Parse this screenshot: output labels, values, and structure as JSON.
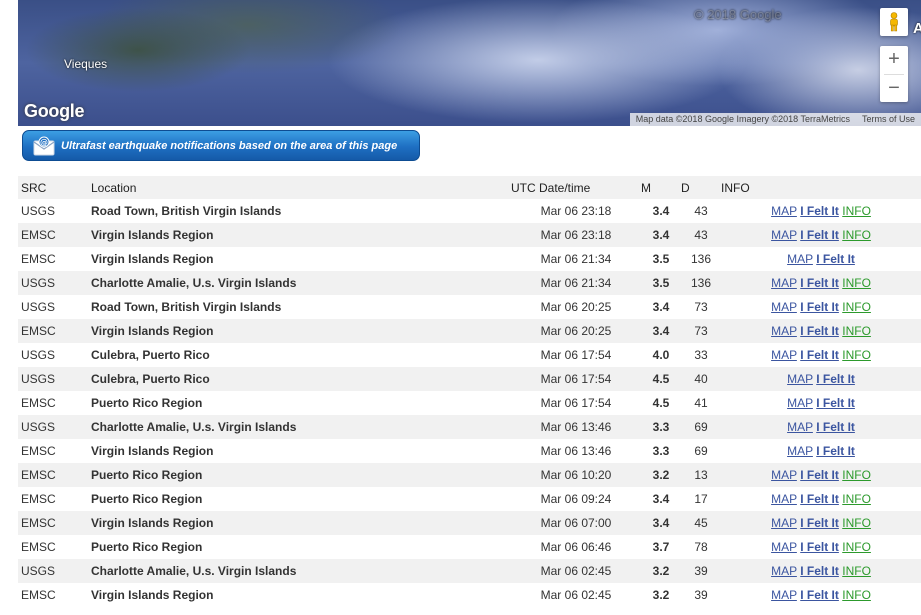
{
  "map": {
    "place_label": "Vieques",
    "logo": "Google",
    "watermark": "© 2018 Google",
    "attribution": "Map data ©2018 Google Imagery ©2018 TerraMetrics",
    "terms": "Terms of Use",
    "zoom_in": "+",
    "zoom_out": "−",
    "side_letter": "A",
    "pegman_icon": "pegman-icon"
  },
  "notify": {
    "label": "Ultrafast earthquake notifications based on the area of this page",
    "icon": "email-notification-icon"
  },
  "table": {
    "headers": {
      "src": "SRC",
      "location": "Location",
      "date": "UTC Date/time",
      "mag": "M",
      "depth": "D",
      "info": "INFO"
    },
    "link_labels": {
      "map": "MAP",
      "felt": "I Felt It",
      "info": "INFO"
    },
    "colors": {
      "link": "#3b55a0",
      "info_link": "#2c9a2c"
    },
    "rows": [
      {
        "src": "USGS",
        "location": "Road Town, British Virgin Islands",
        "date": "Mar 06 23:18",
        "mag": "3.4",
        "depth": "43",
        "has_info": true
      },
      {
        "src": "EMSC",
        "location": "Virgin Islands Region",
        "date": "Mar 06 23:18",
        "mag": "3.4",
        "depth": "43",
        "has_info": true
      },
      {
        "src": "EMSC",
        "location": "Virgin Islands Region",
        "date": "Mar 06 21:34",
        "mag": "3.5",
        "depth": "136",
        "has_info": false
      },
      {
        "src": "USGS",
        "location": "Charlotte Amalie, U.s. Virgin Islands",
        "date": "Mar 06 21:34",
        "mag": "3.5",
        "depth": "136",
        "has_info": true
      },
      {
        "src": "USGS",
        "location": "Road Town, British Virgin Islands",
        "date": "Mar 06 20:25",
        "mag": "3.4",
        "depth": "73",
        "has_info": true
      },
      {
        "src": "EMSC",
        "location": "Virgin Islands Region",
        "date": "Mar 06 20:25",
        "mag": "3.4",
        "depth": "73",
        "has_info": true
      },
      {
        "src": "USGS",
        "location": "Culebra, Puerto Rico",
        "date": "Mar 06 17:54",
        "mag": "4.0",
        "depth": "33",
        "has_info": true
      },
      {
        "src": "USGS",
        "location": "Culebra, Puerto Rico",
        "date": "Mar 06 17:54",
        "mag": "4.5",
        "depth": "40",
        "has_info": false
      },
      {
        "src": "EMSC",
        "location": "Puerto Rico Region",
        "date": "Mar 06 17:54",
        "mag": "4.5",
        "depth": "41",
        "has_info": false
      },
      {
        "src": "USGS",
        "location": "Charlotte Amalie, U.s. Virgin Islands",
        "date": "Mar 06 13:46",
        "mag": "3.3",
        "depth": "69",
        "has_info": false
      },
      {
        "src": "EMSC",
        "location": "Virgin Islands Region",
        "date": "Mar 06 13:46",
        "mag": "3.3",
        "depth": "69",
        "has_info": false
      },
      {
        "src": "EMSC",
        "location": "Puerto Rico Region",
        "date": "Mar 06 10:20",
        "mag": "3.2",
        "depth": "13",
        "has_info": true
      },
      {
        "src": "EMSC",
        "location": "Puerto Rico Region",
        "date": "Mar 06 09:24",
        "mag": "3.4",
        "depth": "17",
        "has_info": true
      },
      {
        "src": "EMSC",
        "location": "Virgin Islands Region",
        "date": "Mar 06 07:00",
        "mag": "3.4",
        "depth": "45",
        "has_info": true
      },
      {
        "src": "EMSC",
        "location": "Puerto Rico Region",
        "date": "Mar 06 06:46",
        "mag": "3.7",
        "depth": "78",
        "has_info": true
      },
      {
        "src": "USGS",
        "location": "Charlotte Amalie, U.s. Virgin Islands",
        "date": "Mar 06 02:45",
        "mag": "3.2",
        "depth": "39",
        "has_info": true
      },
      {
        "src": "EMSC",
        "location": "Virgin Islands Region",
        "date": "Mar 06 02:45",
        "mag": "3.2",
        "depth": "39",
        "has_info": true
      }
    ]
  }
}
